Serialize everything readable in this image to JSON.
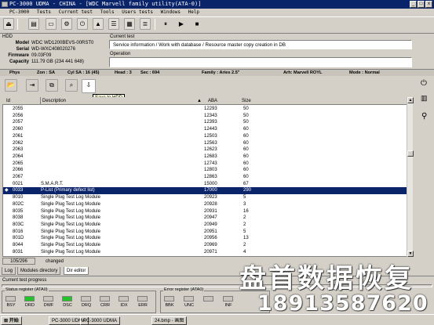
{
  "window": {
    "title": "PC-3000 UDMA - CHINA - [WDC Marvell family utility(ATA-0)]",
    "min_label": "_",
    "max_label": "□",
    "close_label": "x"
  },
  "menu": [
    "PC-3000",
    "Tests",
    "Current test",
    "Tools",
    "Users tests",
    "Windows",
    "Help"
  ],
  "toolbar": {
    "tooltip": "Save to HDD"
  },
  "hdd": {
    "group_label": "HDD",
    "fields": [
      {
        "label": "Model",
        "value": "WDC WD1200BEVS-00RST0"
      },
      {
        "label": "Serial",
        "value": "WD-WXC408020276"
      },
      {
        "label": "Firmware",
        "value": "09.03F09"
      },
      {
        "label": "Capacity",
        "value": "111.79 GB (234 441 648)"
      }
    ]
  },
  "current_test": {
    "label": "Current test",
    "value": "Service information / Work with database / Resource master copy creation in DB",
    "operation_label": "Operation"
  },
  "infobar": {
    "phys": "Phys",
    "zone": "Zon : SA",
    "cyl": "Cyl SA : 16 (45)",
    "head": "Head : 3",
    "sec": "Sec : 694",
    "family": "Family : Aries 2.5\"",
    "arh": "Arh: Marvell ROYL",
    "mode": "Mode : Normal"
  },
  "table": {
    "columns": [
      "Id",
      "Description",
      "ABA",
      "Size"
    ],
    "rows": [
      {
        "id": "2055",
        "desc": "",
        "aba": "12293",
        "size": "50"
      },
      {
        "id": "2056",
        "desc": "",
        "aba": "12343",
        "size": "50"
      },
      {
        "id": "2057",
        "desc": "",
        "aba": "12393",
        "size": "50"
      },
      {
        "id": "2060",
        "desc": "",
        "aba": "12443",
        "size": "60"
      },
      {
        "id": "2061",
        "desc": "",
        "aba": "12503",
        "size": "60"
      },
      {
        "id": "2062",
        "desc": "",
        "aba": "12563",
        "size": "60"
      },
      {
        "id": "2063",
        "desc": "",
        "aba": "12623",
        "size": "60"
      },
      {
        "id": "2064",
        "desc": "",
        "aba": "12683",
        "size": "60"
      },
      {
        "id": "2065",
        "desc": "",
        "aba": "12743",
        "size": "60"
      },
      {
        "id": "2066",
        "desc": "",
        "aba": "12803",
        "size": "60"
      },
      {
        "id": "2067",
        "desc": "",
        "aba": "12863",
        "size": "60"
      },
      {
        "id": "0021",
        "desc": "S.M.A.R.T.",
        "aba": "15000",
        "size": "67"
      },
      {
        "id": "0033",
        "desc": "P-List (Primary defect list)",
        "aba": "17000",
        "size": "290",
        "selected": true
      },
      {
        "id": "8010",
        "desc": "Single Plug Test Log Module",
        "aba": "20923",
        "size": "5"
      },
      {
        "id": "802C",
        "desc": "Single Plug Test Log Module",
        "aba": "20928",
        "size": "3"
      },
      {
        "id": "8035",
        "desc": "Single Plug Test Log Module",
        "aba": "20931",
        "size": "16"
      },
      {
        "id": "8038",
        "desc": "Single Plug Test Log Module",
        "aba": "20947",
        "size": "2"
      },
      {
        "id": "803C",
        "desc": "Single Plug Test Log Module",
        "aba": "20949",
        "size": "2"
      },
      {
        "id": "8016",
        "desc": "Single Plug Test Log Module",
        "aba": "20951",
        "size": "5"
      },
      {
        "id": "801D",
        "desc": "Single Plug Test Log Module",
        "aba": "20956",
        "size": "13"
      },
      {
        "id": "8044",
        "desc": "Single Plug Test Log Module",
        "aba": "20969",
        "size": "2"
      },
      {
        "id": "8031",
        "desc": "Single Plug Test Log Module",
        "aba": "20971",
        "size": "4"
      }
    ]
  },
  "statusrow": {
    "count": "105/296",
    "state": "changed"
  },
  "tabs": [
    "Log",
    "Modules directory",
    "Dir editor"
  ],
  "progress_label": "Current test progress",
  "status_register": {
    "label": "Status register (ATA0)",
    "leds": [
      {
        "name": "BSY",
        "color": "#c8c4bc"
      },
      {
        "name": "DRD",
        "color": "#22c22a"
      },
      {
        "name": "DWF",
        "color": "#c8c4bc"
      },
      {
        "name": "DSC",
        "color": "#22c22a"
      },
      {
        "name": "DRQ",
        "color": "#c8c4bc"
      },
      {
        "name": "CRR",
        "color": "#c8c4bc"
      },
      {
        "name": "IDX",
        "color": "#c8c4bc"
      },
      {
        "name": "ERR",
        "color": "#c8c4bc"
      }
    ]
  },
  "error_register": {
    "label": "Error register (ATA0)",
    "leds": [
      {
        "name": "BBK",
        "color": "#c8c4bc"
      },
      {
        "name": "UNC",
        "color": "#c8c4bc"
      },
      {
        "name": "",
        "color": "#c8c4bc"
      },
      {
        "name": "INF",
        "color": "#c8c4bc"
      }
    ]
  },
  "taskbar": {
    "start": "开始",
    "items": [
      "PC-3000 UDMA",
      "PC-3000 UDMA",
      "24.bmp - 画图"
    ]
  },
  "watermark": {
    "line1": "盘首数据恢复",
    "line2": "18913587620"
  }
}
